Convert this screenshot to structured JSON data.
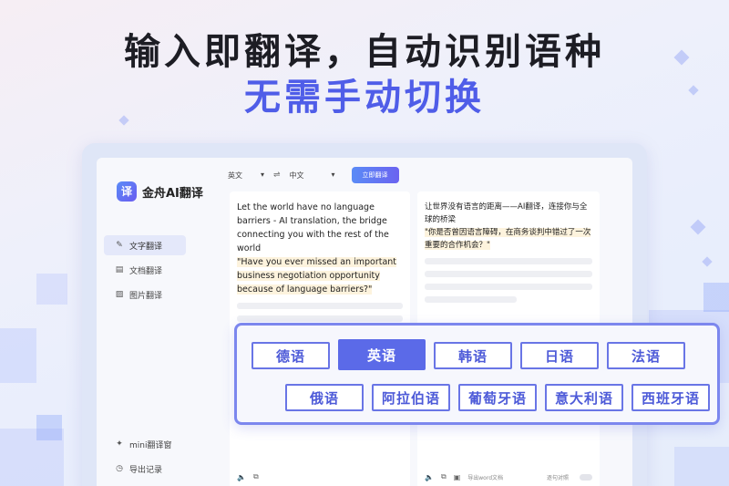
{
  "headline": "输入即翻译，自动识别语种",
  "subline": "无需手动切换",
  "app": {
    "logo_glyph": "译",
    "name": "金舟AI翻译",
    "nav": [
      {
        "label": "文字翻译",
        "icon": "text-translate-icon",
        "active": true
      },
      {
        "label": "文档翻译",
        "icon": "document-icon",
        "active": false
      },
      {
        "label": "图片翻译",
        "icon": "image-icon",
        "active": false
      }
    ],
    "nav_bottom": [
      {
        "label": "mini翻译窗",
        "icon": "mini-window-icon"
      },
      {
        "label": "导出记录",
        "icon": "history-icon"
      }
    ],
    "toolbar": {
      "source_lang": "英文",
      "target_lang": "中文",
      "translate_button": "立即翻译"
    },
    "source_text_plain": "Let the world have no language barriers - AI translation, the bridge connecting you with the rest of the world",
    "source_text_highlight": "\"Have you ever missed an important business negotiation opportunity because of language barriers?\"",
    "target_text_plain": "让世界没有语言的距离——AI翻译，连接你与全球的桥梁",
    "target_text_highlight": "\"你是否曾因语言障碍，在商务谈判中错过了一次重要的合作机会？\"",
    "export_word": "导出word文档",
    "compare_label": "逐句对照"
  },
  "languages": {
    "row1": [
      "德语",
      "英语",
      "韩语",
      "日语",
      "法语"
    ],
    "row2": [
      "俄语",
      "阿拉伯语",
      "葡萄牙语",
      "意大利语",
      "西班牙语"
    ],
    "selected": "英语"
  }
}
